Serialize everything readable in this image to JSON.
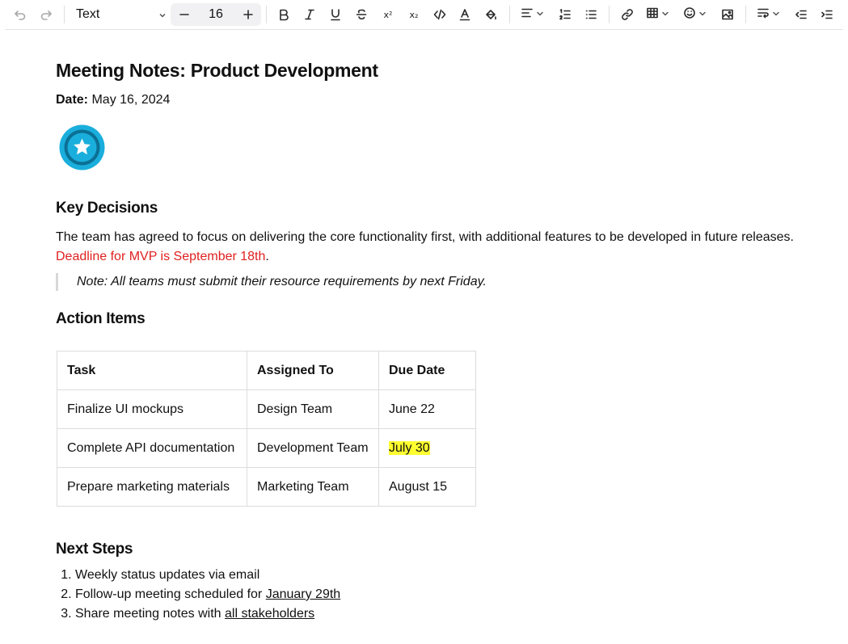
{
  "toolbar": {
    "block_type": "Text",
    "font_size": "16",
    "icons": [
      "undo-icon",
      "redo-icon",
      "chevron-down-icon",
      "minus-icon",
      "plus-icon",
      "bold-icon",
      "italic-icon",
      "underline-icon",
      "strikethrough-icon",
      "superscript-icon",
      "subscript-icon",
      "code-icon",
      "text-color-icon",
      "highlight-icon",
      "align-left-icon",
      "ordered-list-icon",
      "bullet-list-icon",
      "link-icon",
      "table-icon",
      "emoji-icon",
      "image-icon",
      "wrap-icon",
      "outdent-icon",
      "indent-icon"
    ],
    "superscript_glyph": "x²",
    "subscript_glyph": "x₂"
  },
  "document": {
    "title": "Meeting Notes: Product Development",
    "date_label": "Date:",
    "date_value": " May 16, 2024",
    "key_decisions_heading": "Key Decisions",
    "decision_text": "The team has agreed to focus on delivering the core functionality first, with additional features to be developed in future releases. ",
    "decision_deadline": "Deadline for MVP is September 18th",
    "decision_end": ".",
    "note": "Note: All teams must submit their resource requirements by next Friday.",
    "action_items_heading": "Action Items",
    "table": {
      "headers": [
        "Task",
        "Assigned To",
        "Due Date"
      ],
      "rows": [
        [
          "Finalize UI mockups",
          "Design Team",
          "June 22"
        ],
        [
          "Complete API documentation",
          "Development Team",
          "July 30"
        ],
        [
          "Prepare marketing materials",
          "Marketing Team",
          "August 15"
        ]
      ]
    },
    "next_steps_heading": "Next Steps",
    "steps": [
      {
        "text": "Weekly status updates via email",
        "link": ""
      },
      {
        "text": "Follow-up meeting scheduled for ",
        "link": "January 29th"
      },
      {
        "text": "Share meeting notes with ",
        "link": "all stakeholders"
      }
    ]
  },
  "colors": {
    "deadline_red": "#e02020",
    "highlight_yellow": "#ffff30",
    "badge_blue": "#1aaedc"
  }
}
